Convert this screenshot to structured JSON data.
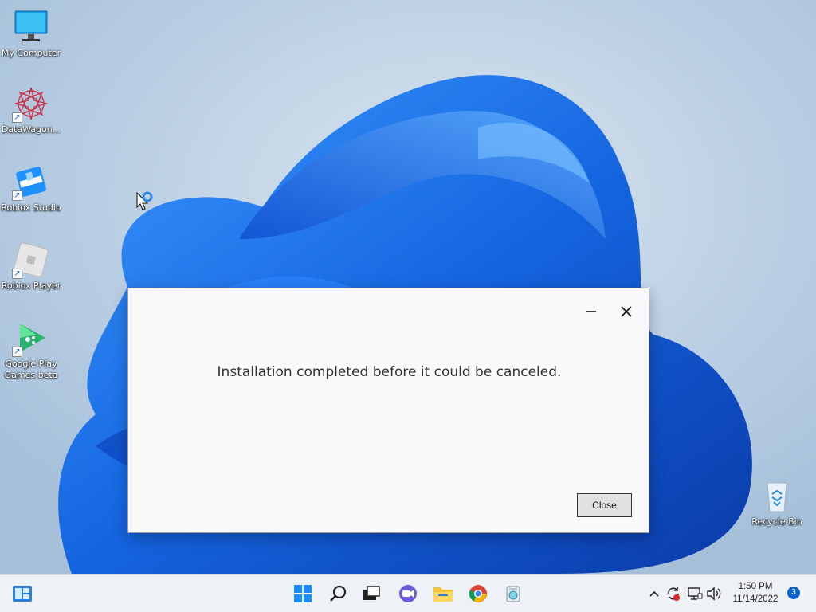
{
  "desktop": {
    "icons": [
      {
        "label": "My Computer",
        "icon": "monitor-icon"
      },
      {
        "label": "DataWagon...",
        "icon": "datawagon-icon"
      },
      {
        "label": "Roblox Studio",
        "icon": "roblox-studio-icon"
      },
      {
        "label": "Roblox Player",
        "icon": "roblox-player-icon"
      },
      {
        "label": "Google Play Games beta",
        "icon": "google-play-games-icon"
      },
      {
        "label": "Recycle Bin",
        "icon": "recycle-bin-icon"
      }
    ]
  },
  "dialog": {
    "message": "Installation completed before it could be canceled.",
    "close_label": "Close"
  },
  "taskbar": {
    "apps": [
      "start-icon",
      "search-icon",
      "task-view-icon",
      "chat-icon",
      "file-explorer-icon",
      "chrome-icon",
      "installer-icon"
    ],
    "clock": {
      "time": "1:50 PM",
      "date": "11/14/2022"
    },
    "notification_count": "3"
  },
  "colors": {
    "accent": "#0b62c9",
    "wallpaper_bloom": "#1565e0",
    "taskbar": "#eef1f5"
  }
}
